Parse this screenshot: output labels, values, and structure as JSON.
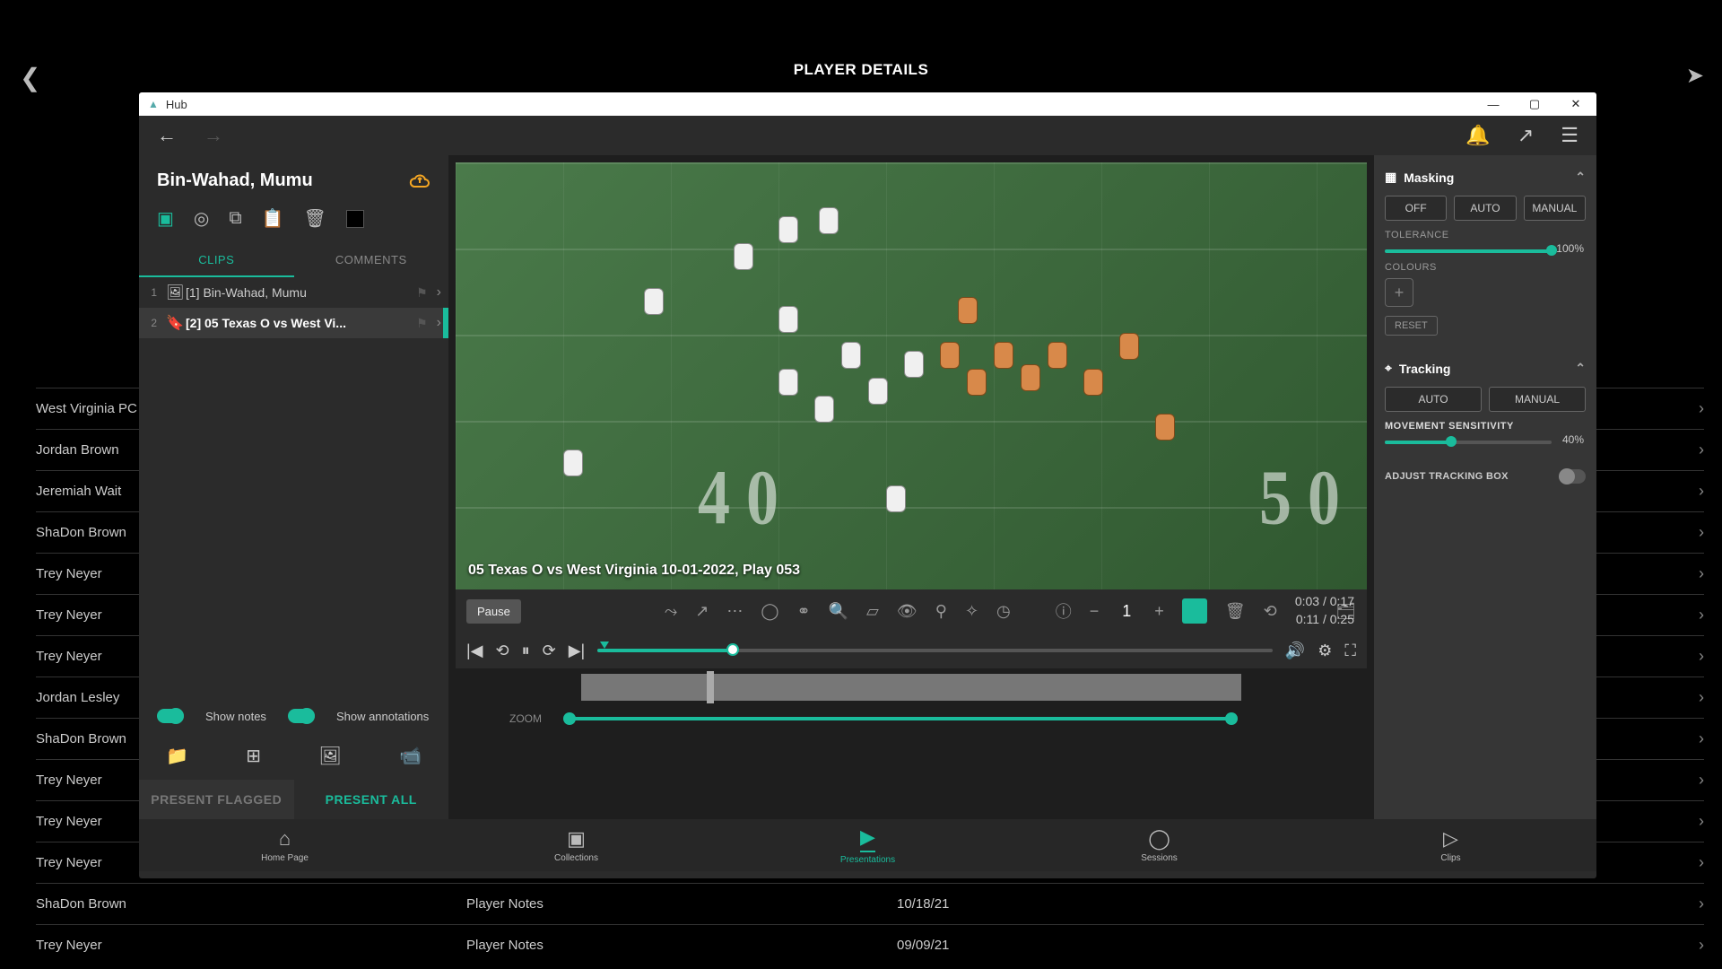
{
  "app": {
    "page_title": "PLAYER DETAILS",
    "window_title": "Hub"
  },
  "sidebar": {
    "title": "Bin-Wahad, Mumu",
    "tabs": {
      "clips": "CLIPS",
      "comments": "COMMENTS"
    },
    "clips": [
      {
        "idx": "1",
        "label": "[1] Bin-Wahad, Mumu",
        "selected": false
      },
      {
        "idx": "2",
        "label": "[2] 05 Texas O vs West Vi...",
        "selected": true
      }
    ],
    "show_notes_label": "Show notes",
    "show_annotations_label": "Show annotations",
    "present_flagged": "PRESENT FLAGGED",
    "present_all": "PRESENT ALL"
  },
  "video": {
    "caption": "05 Texas O vs West Virginia 10-01-2022, Play 053",
    "pause_label": "Pause",
    "frame_count": "1",
    "time_a": "0:03 / 0:17",
    "time_b": "0:11 / 0:25",
    "progress_pct": 20,
    "marker_pct": 1,
    "zoom_label": "ZOOM"
  },
  "props": {
    "masking": {
      "title": "Masking",
      "off": "OFF",
      "auto": "AUTO",
      "manual": "MANUAL",
      "tolerance_label": "TOLERANCE",
      "tolerance_value": "100%",
      "colours_label": "COLOURS",
      "reset": "RESET"
    },
    "tracking": {
      "title": "Tracking",
      "auto": "AUTO",
      "manual": "MANUAL",
      "sensitivity_label": "MOVEMENT SENSITIVITY",
      "sensitivity_value": "40%",
      "adjust_box": "ADJUST TRACKING BOX"
    }
  },
  "bottom_nav": {
    "home": "Home Page",
    "collections": "Collections",
    "presentations": "Presentations",
    "sessions": "Sessions",
    "clips": "Clips"
  },
  "player_rows": [
    {
      "name": "West Virginia PC",
      "note": "",
      "date": ""
    },
    {
      "name": "Jordan Brown",
      "note": "",
      "date": ""
    },
    {
      "name": "Jeremiah Wait",
      "note": "",
      "date": ""
    },
    {
      "name": "ShaDon Brown",
      "note": "",
      "date": ""
    },
    {
      "name": "Trey Neyer",
      "note": "",
      "date": ""
    },
    {
      "name": "Trey Neyer",
      "note": "",
      "date": ""
    },
    {
      "name": "Trey Neyer",
      "note": "",
      "date": ""
    },
    {
      "name": "Jordan Lesley",
      "note": "",
      "date": ""
    },
    {
      "name": "ShaDon Brown",
      "note": "",
      "date": ""
    },
    {
      "name": "Trey Neyer",
      "note": "",
      "date": ""
    },
    {
      "name": "Trey Neyer",
      "note": "",
      "date": ""
    },
    {
      "name": "Trey Neyer",
      "note": "",
      "date": ""
    },
    {
      "name": "ShaDon Brown",
      "note": "Player Notes",
      "date": "10/18/21"
    },
    {
      "name": "Trey Neyer",
      "note": "Player Notes",
      "date": "09/09/21"
    }
  ]
}
